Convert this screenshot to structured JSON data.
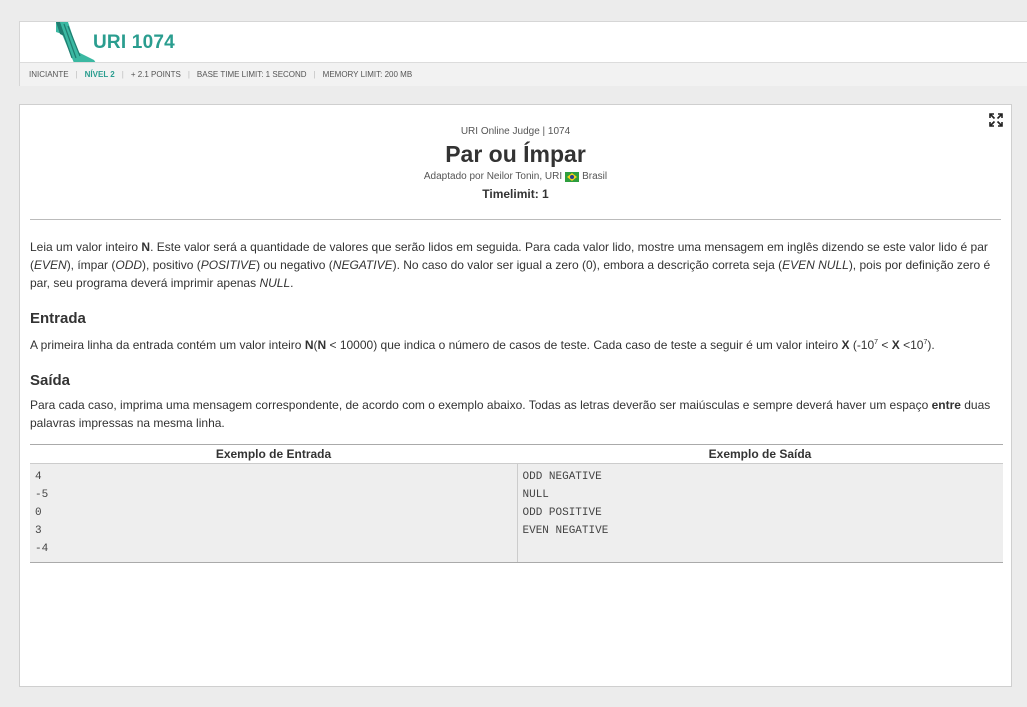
{
  "header": {
    "problem_code": "URI 1074",
    "meta": {
      "category": "INICIANTE",
      "level": "NÍVEL 2",
      "points": "+ 2.1 POINTS",
      "time_limit": "BASE TIME LIMIT: 1 SECOND",
      "memory_limit": "MEMORY LIMIT: 200 MB"
    }
  },
  "problem": {
    "judge_label": "URI Online Judge | 1074",
    "title": "Par ou Ímpar",
    "adapted_prefix": "Adaptado por Neilor Tonin, URI",
    "country": "Brasil",
    "timelimit": "Timelimit: 1",
    "description": {
      "p1": "Leia um valor inteiro ",
      "n": "N",
      "p2": ". Este valor será a quantidade de valores que serão lidos em seguida. Para cada valor lido, mostre uma mensagem em inglês dizendo se este valor lido é par (",
      "even": "EVEN",
      "p3": "), ímpar (",
      "odd": "ODD",
      "p4": "), positivo (",
      "positive": "POSITIVE",
      "p5": ") ou negativo (",
      "negative": "NEGATIVE",
      "p6": "). No caso do valor ser igual a zero (0), embora a descrição correta seja (",
      "even_null": "EVEN NULL",
      "p7": "), pois por definição zero é par, seu programa deverá imprimir apenas ",
      "null": "NULL",
      "p8": "."
    },
    "input_section": {
      "title": "Entrada",
      "t1": "A primeira linha da entrada contém um valor inteiro ",
      "n1": "N",
      "t2": "(",
      "n2": "N",
      "t3": " < 10000) que indica o número de casos de teste. Cada caso de teste a seguir é um valor inteiro ",
      "x1": "X",
      "t4": " (-10",
      "sup1": "7",
      "t5": " < ",
      "x2": "X",
      "t6": " <10",
      "sup2": "7",
      "t7": ")."
    },
    "output_section": {
      "title": "Saída",
      "t1": "Para cada caso, imprima uma mensagem correspondente, de acordo com o exemplo abaixo. Todas as letras deverão ser maiúsculas e sempre deverá haver um espaço ",
      "entre": "entre",
      "t2": " duas palavras impressas na mesma linha."
    },
    "samples": {
      "input_header": "Exemplo de Entrada",
      "output_header": "Exemplo de Saída",
      "input_lines": [
        "4",
        "-5",
        "0",
        "3",
        "-4"
      ],
      "output_lines": [
        "ODD NEGATIVE",
        "NULL",
        "ODD POSITIVE",
        "EVEN NEGATIVE"
      ]
    }
  },
  "colors": {
    "accent": "#2a9d8f",
    "background": "#ececec",
    "sample_bg": "#eeeeee"
  },
  "icons": {
    "logo": "uri-logo",
    "expand": "expand-icon",
    "flag": "brazil-flag-icon"
  }
}
